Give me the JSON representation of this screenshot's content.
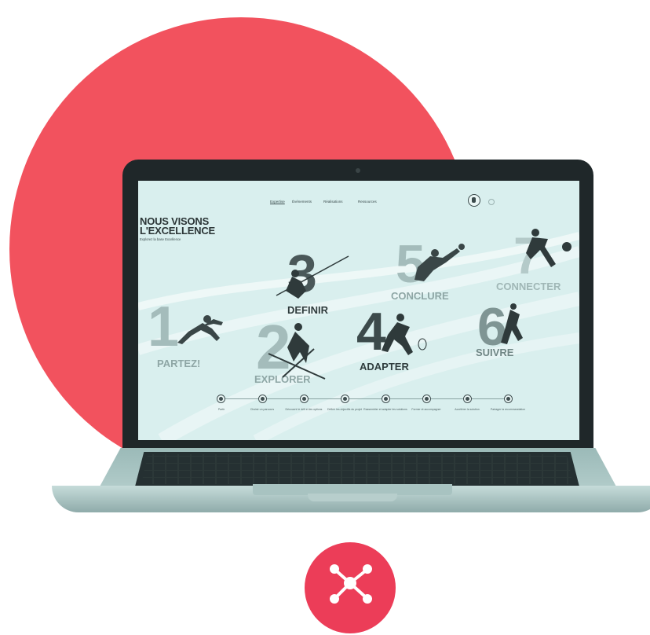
{
  "colors": {
    "accent": "#f2525e",
    "icon_circle": "#ec3d58",
    "screen_bg": "#d9efee",
    "laptop_bezel": "#1f2729"
  },
  "screen": {
    "nav": [
      {
        "label": "Expertise",
        "active": true
      },
      {
        "label": "Événements",
        "active": false
      },
      {
        "label": "Réalisations",
        "active": false
      },
      {
        "label": "Ressources",
        "active": false
      }
    ],
    "hero": {
      "title_line1": "NOUS VISONS",
      "title_line2": "L'EXCELLENCE",
      "subtitle": "Explorez la base Excellence"
    },
    "steps": [
      {
        "number": "1",
        "word": "PARTEZ!"
      },
      {
        "number": "2",
        "word": "EXPLORER"
      },
      {
        "number": "3",
        "word": "DEFINIR"
      },
      {
        "number": "4",
        "word": "ADAPTER"
      },
      {
        "number": "5",
        "word": "CONCLURE"
      },
      {
        "number": "6",
        "word": "SUIVRE"
      },
      {
        "number": "7",
        "word": "CONNECTER"
      }
    ],
    "timeline_labels": [
      "Partir",
      "Choisir un parcours",
      "Découvrir le défi et les options",
      "Définir les objectifs du projet",
      "Rassembler et adapter les solutions",
      "Former et accompagner",
      "Accélérer la solution",
      "Partager la recommandation"
    ]
  },
  "icons": {
    "hub": "network-hub-icon"
  }
}
